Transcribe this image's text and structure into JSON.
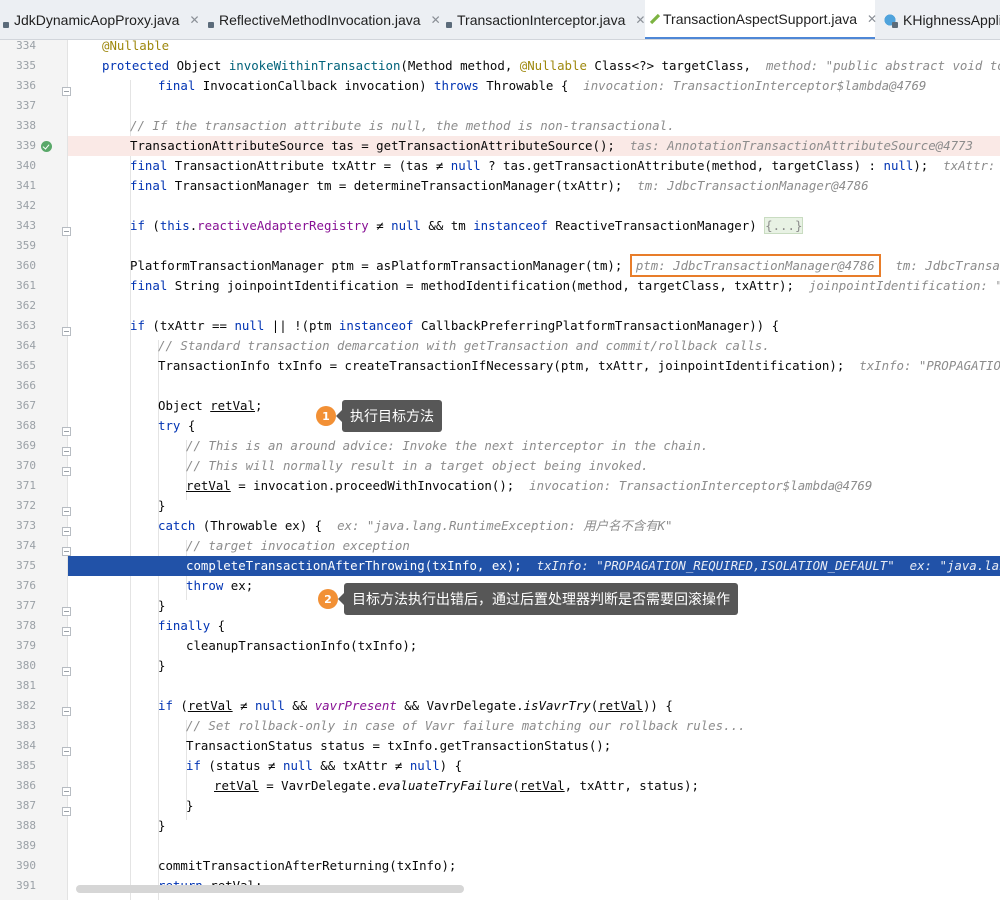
{
  "tabs": [
    {
      "label": "JdkDynamicAopProxy.java",
      "icon": "java-class-icon",
      "active": false
    },
    {
      "label": "ReflectiveMethodInvocation.java",
      "icon": "java-class-icon",
      "active": false
    },
    {
      "label": "TransactionInterceptor.java",
      "icon": "java-class-icon",
      "active": false
    },
    {
      "label": "TransactionAspectSupport.java",
      "icon": "java-aspect-icon",
      "active": true
    },
    {
      "label": "KHighnessApplic",
      "icon": "java-class-icon",
      "active": false
    }
  ],
  "line_numbers": [
    "334",
    "335",
    "336",
    "337",
    "338",
    "339",
    "340",
    "341",
    "342",
    "343",
    "359",
    "360",
    "361",
    "362",
    "363",
    "364",
    "365",
    "366",
    "367",
    "368",
    "369",
    "370",
    "371",
    "372",
    "373",
    "374",
    "375",
    "376",
    "377",
    "378",
    "379",
    "380",
    "381",
    "382",
    "383",
    "384",
    "385",
    "386",
    "387",
    "388",
    "389",
    "390",
    "391"
  ],
  "code": {
    "l334_ann": "@Nullable",
    "l335_kw": "protected",
    "l335_a": " Object ",
    "l335_fn": "invokeWithinTransaction",
    "l335_b": "(Method method, ",
    "l335_ann": "@Nullable",
    "l335_c": " Class<?> targetClass,  ",
    "l335_hint": "method: \"public abstract void top.parak",
    "l336_kw": "final",
    "l336_a": " InvocationCallback invocation) ",
    "l336_kw2": "throws",
    "l336_b": " Throwable {  ",
    "l336_hint": "invocation: TransactionInterceptor$lambda@4769",
    "l338_cm": "// If the transaction attribute is null, the method is non-transactional.",
    "l339_a": "TransactionAttributeSource tas = getTransactionAttributeSource();  ",
    "l339_hint": "tas: AnnotationTransactionAttributeSource@4773",
    "l340_kw": "final",
    "l340_a": " TransactionAttribute txAttr = (tas ≠ ",
    "l340_kw2": "null",
    "l340_b": " ? tas.getTransactionAttribute(method, targetClass) : ",
    "l340_kw3": "null",
    "l340_c": ");  ",
    "l340_hint": "txAttr: \"PROPAG",
    "l341_kw": "final",
    "l341_a": " TransactionManager tm = determineTransactionManager(txAttr);  ",
    "l341_hint": "tm: JdbcTransactionManager@4786",
    "l343_kw": "if",
    "l343_a": " (",
    "l343_kw2": "this",
    "l343_b": ".",
    "l343_fd": "reactiveAdapterRegistry",
    "l343_c": " ≠ ",
    "l343_kw3": "null",
    "l343_d": " && tm ",
    "l343_kw4": "instanceof",
    "l343_e": " ReactiveTransactionManager) ",
    "l343_fold": "{...}",
    "l360_a": "PlatformTransactionManager ptm = asPlatformTransactionManager(tm); ",
    "l360_box": "ptm: JdbcTransactionManager@4786",
    "l360_hint": "  tm: JdbcTransactionMana",
    "l361_kw": "final",
    "l361_a": " String joinpointIdentification = methodIdentification(method, targetClass, txAttr);  ",
    "l361_hint": "joinpointIdentification: \"top.para",
    "l363_kw": "if",
    "l363_a": " (txAttr == ",
    "l363_kw2": "null",
    "l363_b": " || !(ptm ",
    "l363_kw3": "instanceof",
    "l363_c": " CallbackPreferringPlatformTransactionManager)) {",
    "l364_cm": "// Standard transaction demarcation with getTransaction and commit/rollback calls.",
    "l365_a": "TransactionInfo txInfo = createTransactionIfNecessary(ptm, txAttr, joinpointIdentification);  ",
    "l365_hint": "txInfo: \"PROPAGATION_REQUI",
    "l367_a": "Object ",
    "l367_ul": "retVal",
    "l367_b": ";",
    "l368_kw": "try",
    "l368_a": " {",
    "l369_cm": "// This is an around advice: Invoke the next interceptor in the chain.",
    "l370_cm": "// This will normally result in a target object being invoked.",
    "l371_ul": "retVal",
    "l371_a": " = invocation.proceedWithInvocation();  ",
    "l371_hint": "invocation: TransactionInterceptor$lambda@4769",
    "l372_a": "}",
    "l373_kw": "catch",
    "l373_a": " (Throwable ex) {  ",
    "l373_hint": "ex: \"java.lang.RuntimeException: 用户名不含有K\"",
    "l374_cm": "// target invocation exception",
    "l375_a": "completeTransactionAfterThrowing(txInfo, ex);  ",
    "l375_hint": "txInfo: \"PROPAGATION_REQUIRED,ISOLATION_DEFAULT\"  ex: \"java.lang.Runti",
    "l376_kw": "throw",
    "l376_a": " ex;",
    "l377_a": "}",
    "l378_kw": "finally",
    "l378_a": " {",
    "l379_a": "cleanupTransactionInfo(txInfo);",
    "l380_a": "}",
    "l382_kw": "if",
    "l382_a": " (",
    "l382_ul": "retVal",
    "l382_b": " ≠ ",
    "l382_kw2": "null",
    "l382_c": " && ",
    "l382_fd": "vavrPresent",
    "l382_d": " && VavrDelegate.",
    "l382_it": "isVavrTry",
    "l382_e": "(",
    "l382_ul2": "retVal",
    "l382_f": ")) {",
    "l383_cm": "// Set rollback-only in case of Vavr failure matching our rollback rules...",
    "l384_a": "TransactionStatus status = txInfo.getTransactionStatus();",
    "l385_kw": "if",
    "l385_a": " (status ≠ ",
    "l385_kw2": "null",
    "l385_b": " && txAttr ≠ ",
    "l385_kw3": "null",
    "l385_c": ") {",
    "l386_ul": "retVal",
    "l386_a": " = VavrDelegate.",
    "l386_it": "evaluateTryFailure",
    "l386_b": "(",
    "l386_ul2": "retVal",
    "l386_c": ", txAttr, status);",
    "l387_a": "}",
    "l388_a": "}",
    "l390_a": "commitTransactionAfterReturning(txInfo);",
    "l391_kw": "return",
    "l391_a": " ",
    "l391_ul": "retVal",
    "l391_b": ";"
  },
  "callouts": [
    {
      "number": "1",
      "text": "执行目标方法"
    },
    {
      "number": "2",
      "text": "目标方法执行出错后，通过后置处理器判断是否需要回滚操作"
    }
  ],
  "colors": {
    "keyword": "#0033b3",
    "annotation": "#9e880d",
    "comment": "#8c8c8c",
    "field": "#871094",
    "selection": "#2152a8",
    "breakpoint_line": "#fae9e6",
    "callout_badge": "#f29035",
    "callout_bubble": "#575757",
    "highlight_box": "#e87d2a"
  }
}
